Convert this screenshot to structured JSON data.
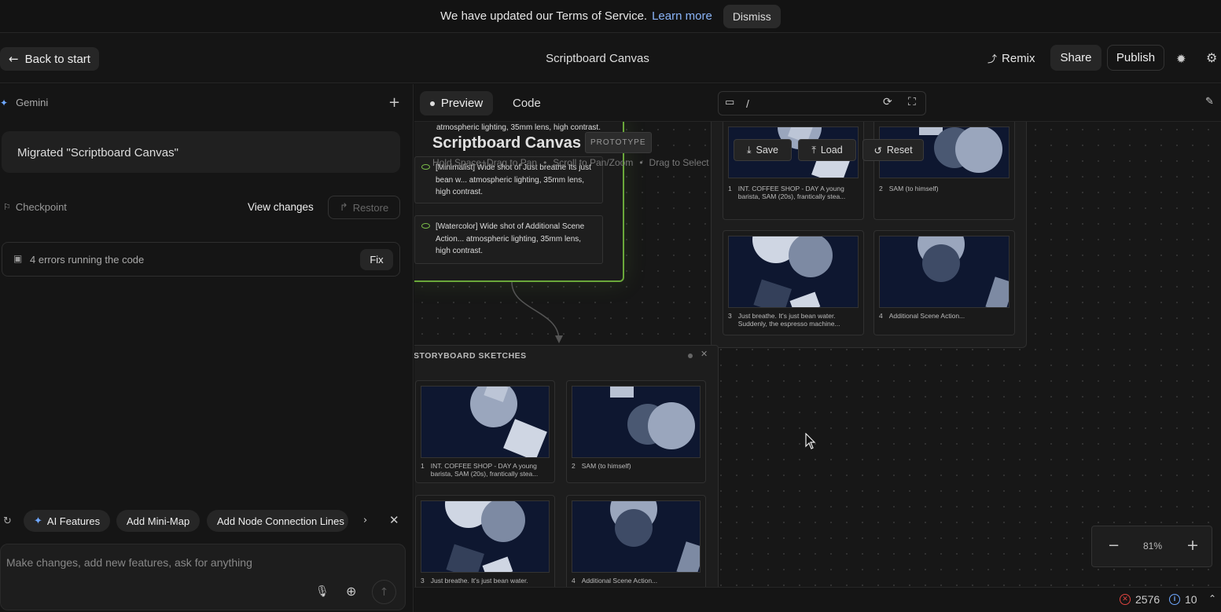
{
  "banner": {
    "text": "We have updated our Terms of Service.",
    "link": "Learn more",
    "dismiss": "Dismiss"
  },
  "header": {
    "back": "Back to start",
    "title": "Scriptboard Canvas",
    "remix": "Remix",
    "share": "Share",
    "publish": "Publish"
  },
  "left": {
    "model": "Gemini",
    "message": "Migrated \"Scriptboard Canvas\"",
    "checkpoint": "Checkpoint",
    "view_changes": "View changes",
    "restore": "Restore",
    "errors": "4 errors running the code",
    "fix": "Fix",
    "suggestions": [
      "AI Features",
      "Add Mini-Map",
      "Add Node Connection Lines"
    ],
    "input_placeholder": "Make changes, add new features, ask for anything"
  },
  "toolbar": {
    "preview": "Preview",
    "code": "Code",
    "path": "/"
  },
  "canvas": {
    "app_title": "Scriptboard Canvas",
    "badge": "PROTOTYPE",
    "hints": [
      "Hold Space+Drag to Pan",
      "Scroll to Pan/Zoom",
      "Drag to Select"
    ],
    "save": "Save",
    "load": "Load",
    "reset": "Reset",
    "prompt_top_text": "atmospheric lighting, 35mm lens, high contrast.",
    "prompts": [
      "[Minimalist] Wide shot of Just breathe Its just bean w... atmospheric lighting, 35mm lens, high contrast.",
      "[Watercolor] Wide shot of Additional Scene Action... atmospheric lighting, 35mm lens, high contrast."
    ],
    "storyboard_title": "STORYBOARD SKETCHES",
    "frames": [
      {
        "num": "1",
        "caption": "INT. COFFEE SHOP - DAY A young barista, SAM (20s), frantically stea..."
      },
      {
        "num": "2",
        "caption": "SAM (to himself)"
      },
      {
        "num": "3",
        "caption": "Just breathe. It's just bean water. Suddenly, the espresso machine..."
      },
      {
        "num": "4",
        "caption": "Additional Scene Action..."
      }
    ],
    "frames_bottom": [
      {
        "num": "1",
        "caption": "INT. COFFEE SHOP - DAY A young barista, SAM (20s), frantically stea..."
      },
      {
        "num": "2",
        "caption": "SAM (to himself)"
      },
      {
        "num": "3",
        "caption": "Just breathe. It's just bean water."
      },
      {
        "num": "4",
        "caption": "Additional Scene Action..."
      }
    ],
    "zoom": "81%"
  },
  "status": {
    "errors": "2576",
    "info": "10"
  },
  "colors": {
    "accent_link": "#8ab4f8",
    "node_border_green": "#7cc04a",
    "error_red": "#e0443f",
    "info_blue": "#6fa8ff"
  }
}
